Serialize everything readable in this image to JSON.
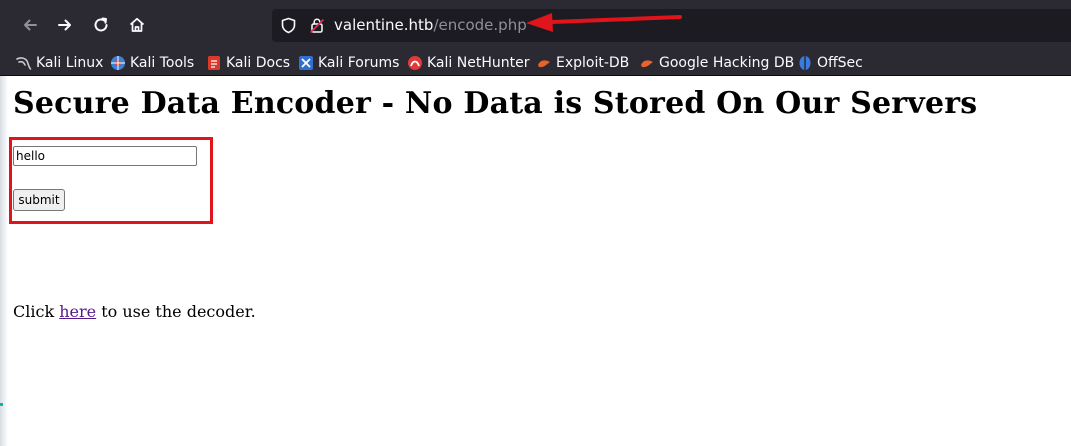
{
  "browser": {
    "url_domain": "valentine.htb",
    "url_path": "/encode.php",
    "bookmarks": [
      {
        "label": "Kali Linux",
        "icon": "kali-dragon-icon"
      },
      {
        "label": "Kali Tools",
        "icon": "kali-tools-icon"
      },
      {
        "label": "Kali Docs",
        "icon": "kali-docs-icon"
      },
      {
        "label": "Kali Forums",
        "icon": "kali-forums-icon"
      },
      {
        "label": "Kali NetHunter",
        "icon": "nethunter-icon"
      },
      {
        "label": "Exploit-DB",
        "icon": "exploit-db-icon"
      },
      {
        "label": "Google Hacking DB",
        "icon": "ghdb-icon"
      },
      {
        "label": "OffSec",
        "icon": "offsec-icon"
      }
    ]
  },
  "page": {
    "title": "Secure Data Encoder - No Data is Stored On Our Servers",
    "input_value": "hello",
    "submit_label": "submit",
    "footer_before": "Click ",
    "footer_link": "here",
    "footer_after": " to use the decoder."
  },
  "colors": {
    "annotation_red": "#e0141b",
    "toolbar_bg": "#2b2a33",
    "link_visited": "#551a8b"
  }
}
